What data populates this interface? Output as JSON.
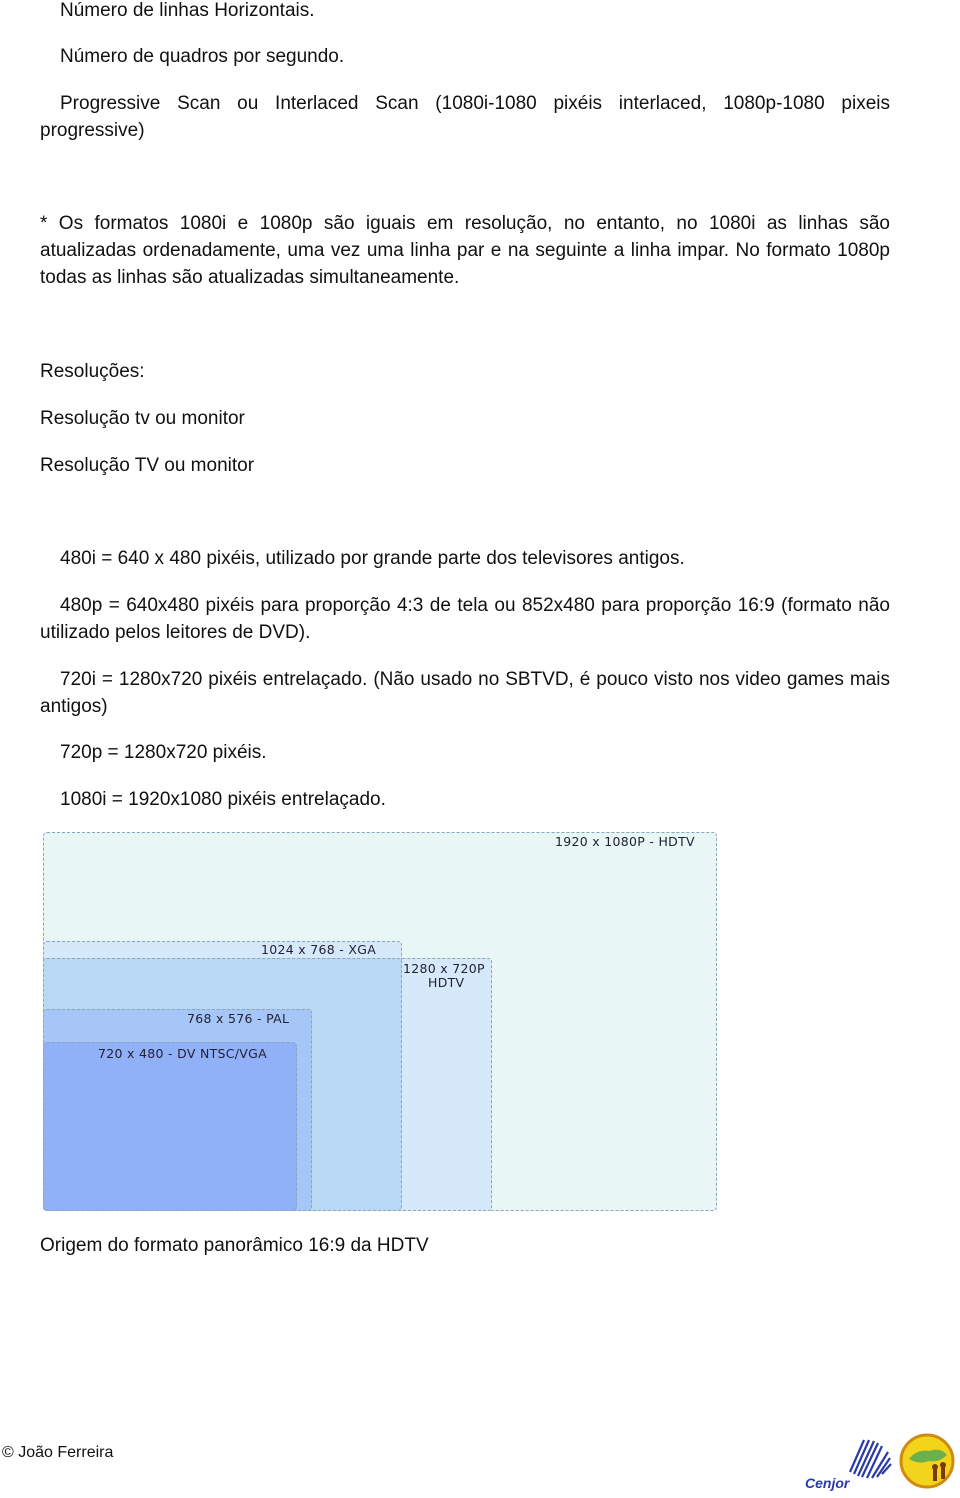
{
  "paragraphs": [
    "Número de linhas Horizontais.",
    "Número de quadros por segundo.",
    "Progressive Scan ou Interlaced Scan (1080i-1080 pixéis interlaced, 1080p-1080 pixeis progressive)",
    "* Os formatos 1080i e 1080p são iguais em resolução, no entanto, no 1080i as linhas são atualizadas ordenadamente, uma vez uma linha par e na seguinte a linha impar. No formato 1080p todas as linhas são atualizadas simultaneamente.",
    "Resoluções:",
    "Resolução tv ou monitor",
    "Resolução TV ou monitor",
    "480i = 640 x 480 pixéis, utilizado por grande parte dos televisores antigos.",
    "480p = 640x480 pixéis para proporção 4:3 de tela ou 852x480 para proporção 16:9 (formato não utilizado pelos leitores de DVD).",
    "720i = 1280x720 pixéis entrelaçado. (Não usado no SBTVD, é pouco visto nos video games mais antigos)",
    "720p = 1280x720 pixéis.",
    "1080i = 1920x1080 pixéis entrelaçado."
  ],
  "diagram": {
    "labels": {
      "hdtv1080": "1920 x 1080P - HDTV",
      "xga": "1024 x 768 - XGA",
      "hdtv720_line1": "1280 x 720P",
      "hdtv720_line2": "HDTV",
      "pal": "768 x 576 - PAL",
      "ntsc": "720 x 480 - DV NTSC/VGA"
    },
    "colors": {
      "hdtv1080": "#e8f6f6",
      "hdtv720": "#d6e9fa",
      "xga": "#d6e9fa",
      "overlap": "#b8d8f4",
      "pal": "#a6c6f8",
      "ntsc": "#90b0f8"
    }
  },
  "caption": "Origem do formato panorâmico 16:9 da HDTV",
  "footer": {
    "copyright": "© João Ferreira",
    "logos": [
      "Cenjor",
      "circular yellow emblem"
    ]
  }
}
